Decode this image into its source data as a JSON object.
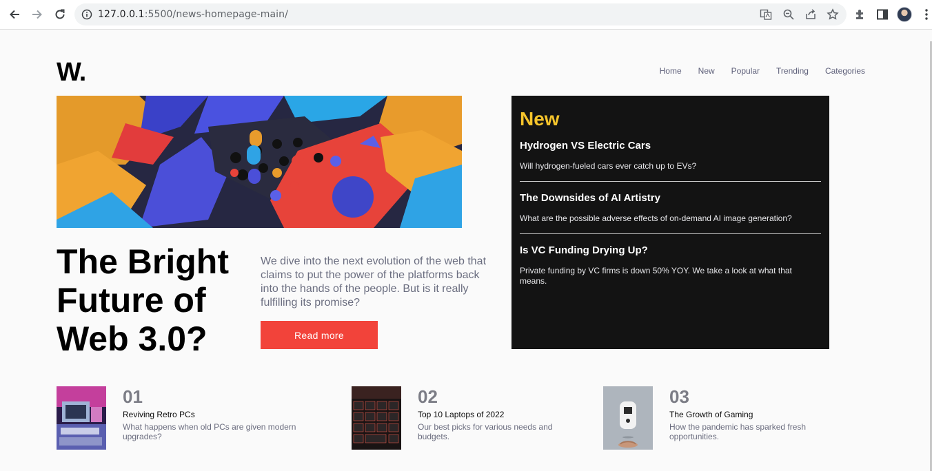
{
  "browser": {
    "url_host": "127.0.0.1",
    "url_rest": ":5500/news-homepage-main/"
  },
  "site": {
    "logo": "W.",
    "nav": [
      "Home",
      "New",
      "Popular",
      "Trending",
      "Categories"
    ]
  },
  "hero": {
    "headline": "The Bright Future of Web 3.0?",
    "lead": "We dive into the next evolution of the web that claims to put the power of the platforms back into the hands of the people. But is it really fulfilling its promise?",
    "cta": "Read more"
  },
  "new_panel": {
    "title": "New",
    "items": [
      {
        "title": "Hydrogen VS Electric Cars",
        "desc": "Will hydrogen-fueled cars ever catch up to EVs?"
      },
      {
        "title": "The Downsides of AI Artistry",
        "desc": "What are the possible adverse effects of on-demand AI image generation?"
      },
      {
        "title": "Is VC Funding Drying Up?",
        "desc": "Private funding by VC firms is down 50% YOY. We take a look at what that means."
      }
    ]
  },
  "bottom": [
    {
      "num": "01",
      "title": "Reviving Retro PCs",
      "desc": "What happens when old PCs are given modern upgrades?"
    },
    {
      "num": "02",
      "title": "Top 10 Laptops of 2022",
      "desc": "Our best picks for various needs and budgets."
    },
    {
      "num": "03",
      "title": "The Growth of Gaming",
      "desc": "How the pandemic has sparked fresh opportunities."
    }
  ],
  "colors": {
    "accent_red": "#f2433a",
    "accent_yellow": "#f5c42b",
    "panel_dark": "#131313",
    "text_dark": "#000000"
  }
}
